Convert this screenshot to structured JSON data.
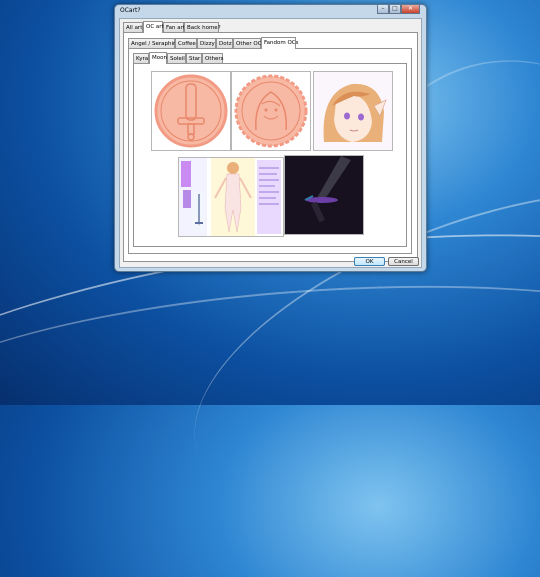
{
  "window": {
    "title": "OCart?",
    "controls": {
      "minimize": "–",
      "maximize": "□",
      "close": "✕"
    }
  },
  "top_tabs": [
    {
      "label": "All art"
    },
    {
      "label": "OC art"
    },
    {
      "label": "Fan art"
    },
    {
      "label": "Back home?"
    }
  ],
  "top_tab_selected": "OC art",
  "second_tabs": [
    {
      "label": "Angel / Seraphim"
    },
    {
      "label": "Coffee"
    },
    {
      "label": "Dizzy"
    },
    {
      "label": "Dotz"
    },
    {
      "label": "Other OCs"
    },
    {
      "label": "Fandom OCs"
    }
  ],
  "second_tab_selected": "Fandom OCs",
  "third_tabs": [
    {
      "label": "Kyra"
    },
    {
      "label": "Moon"
    },
    {
      "label": "Soleil"
    },
    {
      "label": "Star"
    },
    {
      "label": "Others"
    }
  ],
  "third_tab_selected": "Moon",
  "gallery": [
    {
      "name": "sword-coin-art"
    },
    {
      "name": "portrait-coin-art"
    },
    {
      "name": "character-face-art"
    },
    {
      "name": "reference-sheet-art"
    },
    {
      "name": "dark-sword-art"
    }
  ],
  "buttons": {
    "ok": "OK",
    "cancel": "Cancel"
  },
  "colors": {
    "coin": "#f7b9a4",
    "coin_line": "#e9876b",
    "hair": "#e9a56a",
    "accent_purple": "#6c3fa8"
  }
}
